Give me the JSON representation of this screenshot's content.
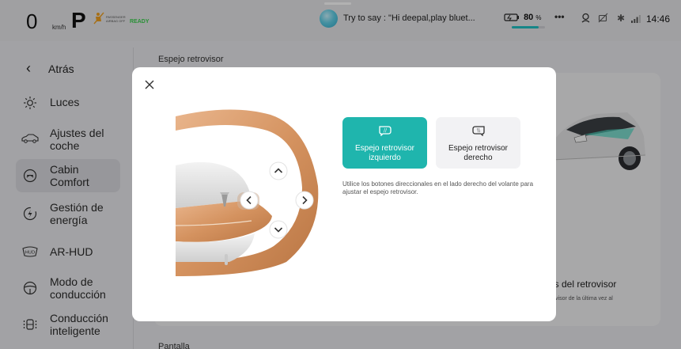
{
  "status_bar": {
    "speed": "0",
    "speed_unit": "km/h",
    "gear": "P",
    "airbag_text": "PASSENGER AIRBAG OFF",
    "ready": "READY",
    "voice_hint": "Try to say : \"Hi deepal,play bluet...",
    "battery_percent": "80",
    "battery_unit": "%",
    "battery_level": 0.8,
    "more_icon": "more-icon",
    "time": "14:46"
  },
  "sidebar": {
    "back_label": "Atrás",
    "items": [
      {
        "label": "Luces",
        "icon": "sun-icon",
        "active": false
      },
      {
        "label": "Ajustes del coche",
        "icon": "car-icon",
        "active": false
      },
      {
        "label": "Cabin Comfort",
        "icon": "seat-icon",
        "active": true
      },
      {
        "label": "Gestión de energía",
        "icon": "energy-icon",
        "active": false
      },
      {
        "label": "AR-HUD",
        "icon": "hud-icon",
        "active": false
      },
      {
        "label": "Modo de conducción",
        "icon": "steering-icon",
        "active": false
      },
      {
        "label": "Conducción inteligente",
        "icon": "smart-drive-icon",
        "active": false
      }
    ]
  },
  "content": {
    "section_title": "Espejo retrovisor",
    "section_title_2": "Pantalla",
    "card_title_partial": "rás del retrovisor",
    "card_subtitle_partial": "etrovisor de la última vez al"
  },
  "modal": {
    "left_button_label": "Espejo retrovisor izquierdo",
    "right_button_label": "Espejo retrovisor derecho",
    "hint": "Utilice los botones direccionales en el lado derecho del volante para ajustar el espejo retrovisor.",
    "accent_color": "#1fb5ad"
  }
}
